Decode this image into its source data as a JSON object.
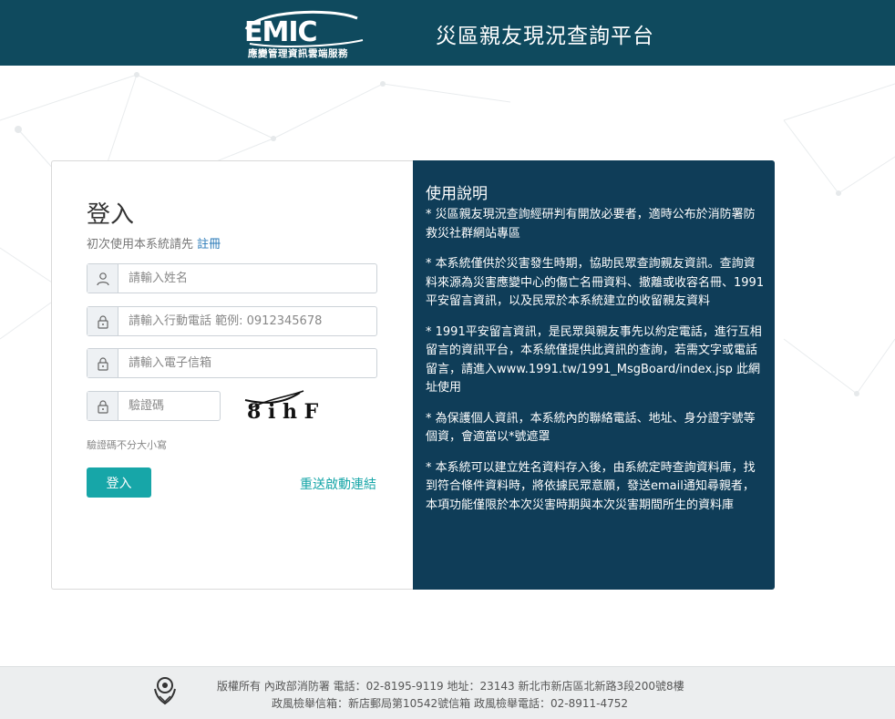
{
  "header": {
    "logo_text": "EMIC",
    "logo_subtitle": "應變管理資訊雲端服務",
    "site_title": "災區親友現況查詢平台"
  },
  "login": {
    "title": "登入",
    "first_time_text": "初次使用本系統請先",
    "register_link": "註冊",
    "name_placeholder": "請輸入姓名",
    "phone_placeholder": "請輸入行動電話 範例: 0912345678",
    "email_placeholder": "請輸入電子信箱",
    "captcha_placeholder": "驗證碼",
    "captcha_text": "8 i h F",
    "captcha_note": "驗證碼不分大小寫",
    "login_button": "登入",
    "resend_link": "重送啟動連結"
  },
  "help": {
    "title": "使用說明",
    "items": [
      "* 災區親友現況查詢經研判有開放必要者，適時公布於消防署防救災社群網站專區",
      "* 本系統僅供於災害發生時期，協助民眾查詢親友資訊。查詢資料來源為災害應變中心的傷亡名冊資料、撤離或收容名冊、1991平安留言資訊，以及民眾於本系統建立的收留親友資料",
      "* 1991平安留言資訊，是民眾與親友事先以約定電話，進行互相留言的資訊平台，本系統僅提供此資訊的查詢，若需文字或電話留言，請進入www.1991.tw/1991_MsgBoard/index.jsp 此網址使用",
      "* 為保護個人資訊，本系統內的聯絡電話、地址、身分證字號等個資，會適當以*號遮罩",
      "* 本系統可以建立姓名資料存入後，由系統定時查詢資料庫，找到符合條件資料時，將依據民眾意願，發送email通知尋親者，本項功能僅限於本次災害時期與本次災害期間所生的資料庫"
    ]
  },
  "footer": {
    "line1": "版權所有 內政部消防署  電話：02-8195-9119  地址：23143 新北市新店區北新路3段200號8樓",
    "line2": "政風檢舉信箱：新店郵局第10542號信箱  政風檢舉電話：02-8911-4752"
  },
  "colors": {
    "header_bg": "#0f4a5e",
    "help_bg": "#0f3d58",
    "accent": "#17a6a8",
    "link": "#2a7ab8"
  },
  "icons": {
    "name_field": "user-icon",
    "phone_field": "lock-icon",
    "email_field": "lock-icon",
    "captcha_field": "lock-icon",
    "footer": "emblem-icon"
  }
}
